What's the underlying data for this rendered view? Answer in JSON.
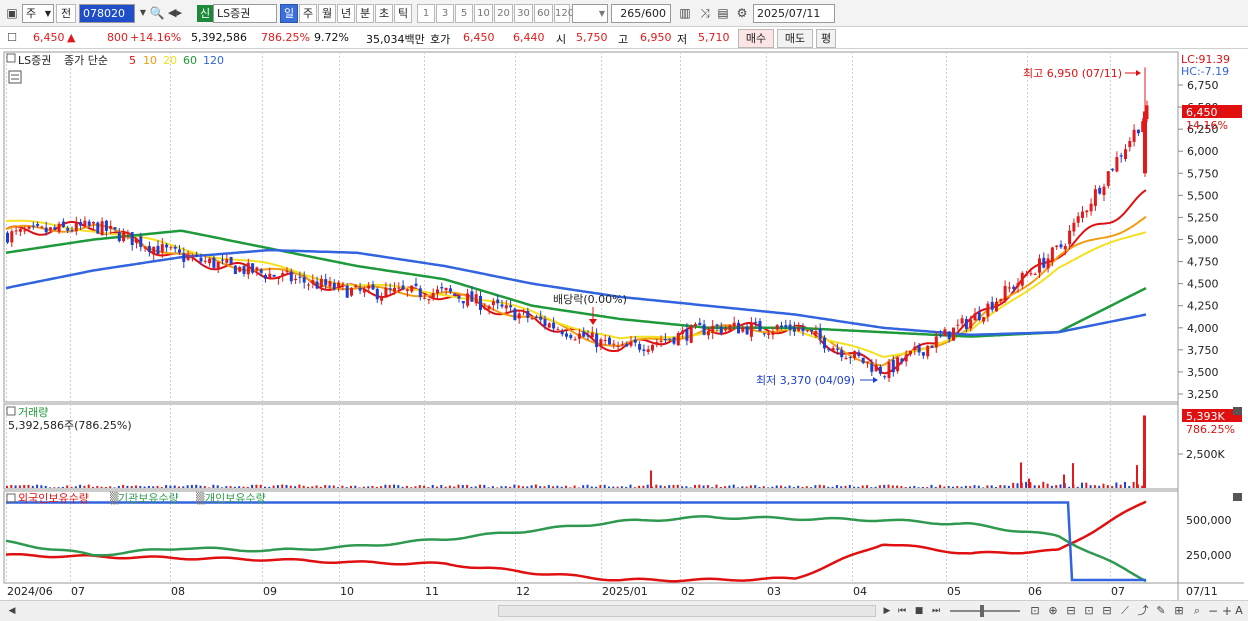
{
  "toolbar": {
    "period_main": "주",
    "prev_label": "전",
    "stock_code": "078020",
    "credit_tag": "신",
    "stock_name": "LS증권",
    "periods": [
      "일",
      "주",
      "월",
      "년",
      "분",
      "초",
      "틱"
    ],
    "numbers": [
      "1",
      "3",
      "5",
      "10",
      "20",
      "30",
      "60",
      "120"
    ],
    "count_current": "265",
    "count_total": "/600",
    "date": "2025/07/11"
  },
  "quote": {
    "price": "6,450",
    "up_arrow": "▲",
    "change": "800",
    "change_pct": "+14.16%",
    "volume": "5,392,586",
    "volume_ratio": "786.25%",
    "turnover": "9.72%",
    "amount": "35,034백만",
    "hoga_label": "호가",
    "ask": "6,450",
    "bid": "6,440",
    "open_label": "시",
    "open": "5,750",
    "high_label": "고",
    "high": "6,950",
    "low_label": "저",
    "low": "5,710",
    "buy_btn": "매수",
    "sell_btn": "매도",
    "eval_btn": "평"
  },
  "price_panel": {
    "stock_tag": "LS증권",
    "legend_prefix": "종가 단순",
    "ma_labels": [
      "5",
      "10",
      "20",
      "60",
      "120"
    ],
    "lc": "LC:91.39",
    "hc": "HC:-7.19",
    "high_annotation": "최고 6,950 (07/11)",
    "low_annotation": "최저 3,370 (04/09)",
    "dividend_annotation": "배당락(0.00%)",
    "current_price_tag": "6,450",
    "current_pct_tag": "14.16%",
    "y_ticks": [
      "6,750",
      "6,500",
      "6,250",
      "6,000",
      "5,750",
      "5,500",
      "5,250",
      "5,000",
      "4,750",
      "4,500",
      "4,250",
      "4,000",
      "3,750",
      "3,500",
      "3,250"
    ]
  },
  "volume_panel": {
    "title": "거래량",
    "value_text": "5,392,586주(786.25%)",
    "tag_value": "5,393K",
    "tag_pct": "786.25%",
    "y_tick": "2,500K"
  },
  "holdings_panel": {
    "legend": [
      "외국인보유수량",
      "기관보유수량",
      "개인보유수량"
    ],
    "y_ticks": [
      "500,000",
      "250,000"
    ]
  },
  "x_axis": {
    "labels": [
      "2024/06",
      "07",
      "08",
      "09",
      "10",
      "11",
      "12",
      "2025/01",
      "02",
      "03",
      "04",
      "05",
      "06",
      "07"
    ],
    "right_label": "07/11"
  },
  "colors": {
    "up": "#e11b1b",
    "down": "#1f3fd0",
    "ma5": "#e01010",
    "ma10": "#f39c12",
    "ma20": "#f4e020",
    "ma60": "#1e9a3a",
    "ma120": "#3264e0",
    "foreign": "#e01010",
    "institution": "#2f9a4f",
    "individual": "#3264e0"
  },
  "chart_data": {
    "type": "candlestick",
    "title": "LS증권",
    "x_range": [
      "2024/06",
      "2025/07/11"
    ],
    "price_range": [
      3200,
      6950
    ],
    "high": {
      "value": 6950,
      "date": "07/11"
    },
    "low": {
      "value": 3370,
      "date": "04/09"
    },
    "last_close": 6450,
    "series": [
      {
        "name": "종가",
        "x": [
          "2024/06",
          "2024/07",
          "2024/08",
          "2024/09",
          "2024/10",
          "2024/11",
          "2024/12",
          "2025/01",
          "2025/02",
          "2025/03",
          "2025/04",
          "2025/05",
          "2025/06",
          "2025/07"
        ],
        "values": [
          5050,
          5150,
          4800,
          4600,
          4400,
          4400,
          4100,
          3750,
          4000,
          4000,
          3500,
          4100,
          4900,
          6450
        ]
      },
      {
        "name": "5",
        "values": [
          5080,
          5160,
          4780,
          4620,
          4420,
          4380,
          4100,
          3760,
          3990,
          4000,
          3520,
          4050,
          4850,
          5500
        ]
      },
      {
        "name": "10",
        "values": [
          5100,
          5150,
          4820,
          4650,
          4430,
          4390,
          4110,
          3780,
          3980,
          4000,
          3560,
          4000,
          4800,
          5250
        ]
      },
      {
        "name": "20",
        "values": [
          5200,
          5120,
          4900,
          4700,
          4480,
          4400,
          4180,
          3850,
          3960,
          4000,
          3650,
          3950,
          4700,
          5100
        ]
      },
      {
        "name": "60",
        "values": [
          4850,
          5000,
          5100,
          4900,
          4700,
          4550,
          4250,
          4100,
          4000,
          4000,
          3950,
          3900,
          3950,
          4450
        ]
      },
      {
        "name": "120",
        "values": [
          4450,
          4650,
          4800,
          4880,
          4850,
          4700,
          4500,
          4350,
          4250,
          4150,
          4000,
          3920,
          3950,
          4150
        ]
      }
    ],
    "volume_series": {
      "name": "거래량",
      "last": 5392586,
      "ylim": [
        0,
        5500000
      ]
    },
    "holding_series": [
      {
        "name": "외국인보유수량",
        "values": [
          270000,
          260000,
          250000,
          240000,
          220000,
          210000,
          150000,
          100000,
          100000,
          110000,
          350000,
          280000,
          300000,
          640000
        ]
      },
      {
        "name": "기관보유수량",
        "values": [
          360000,
          270000,
          320000,
          300000,
          330000,
          380000,
          440000,
          500000,
          530000,
          520000,
          510000,
          480000,
          400000,
          100000
        ]
      },
      {
        "name": "개인보유수량",
        "values": [
          630000,
          630000,
          630000,
          630000,
          630000,
          630000,
          630000,
          630000,
          630000,
          630000,
          630000,
          630000,
          630000,
          100000
        ]
      }
    ]
  }
}
